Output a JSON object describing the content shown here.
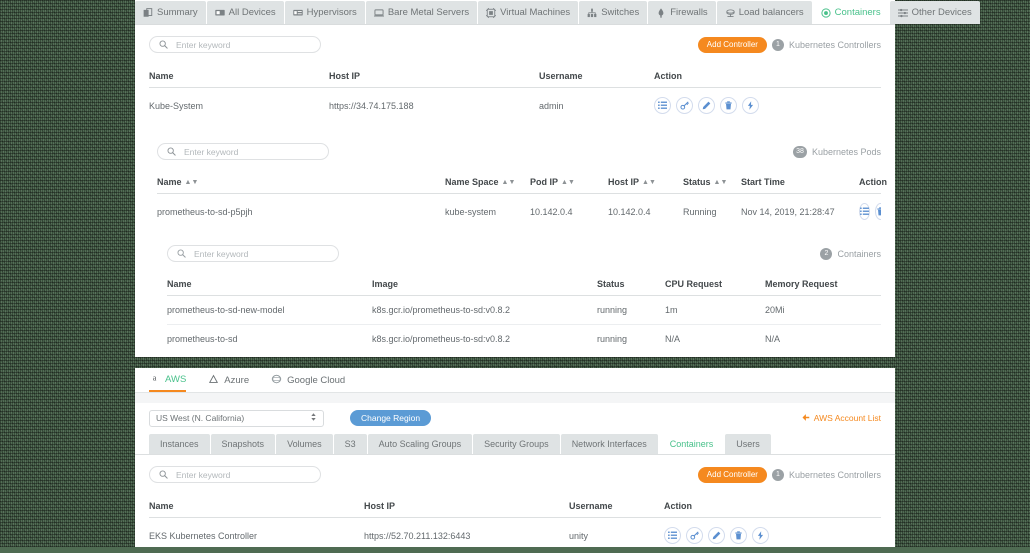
{
  "top_panel": {
    "nav_tabs": [
      {
        "label": "Summary",
        "icon": "summary-icon",
        "active": false
      },
      {
        "label": "All Devices",
        "icon": "devices-icon",
        "active": false
      },
      {
        "label": "Hypervisors",
        "icon": "hypervisor-icon",
        "active": false
      },
      {
        "label": "Bare Metal Servers",
        "icon": "server-icon",
        "active": false
      },
      {
        "label": "Virtual Machines",
        "icon": "vm-icon",
        "active": false
      },
      {
        "label": "Switches",
        "icon": "switch-icon",
        "active": false
      },
      {
        "label": "Firewalls",
        "icon": "firewall-icon",
        "active": false
      },
      {
        "label": "Load balancers",
        "icon": "loadbalancer-icon",
        "active": false
      },
      {
        "label": "Containers",
        "icon": "container-icon",
        "active": true
      },
      {
        "label": "Other Devices",
        "icon": "other-devices-icon",
        "active": false
      }
    ],
    "controllers": {
      "search_placeholder": "Enter keyword",
      "search_value": "",
      "add_button": "Add Controller",
      "count": "1",
      "count_label": "Kubernetes Controllers",
      "columns": [
        "Name",
        "Host IP",
        "Username",
        "Action"
      ],
      "rows": [
        {
          "name": "Kube-System",
          "host_ip": "https://34.74.175.188",
          "username": "admin",
          "actions": [
            "list-icon",
            "key-icon",
            "edit-icon",
            "delete-icon",
            "connect-icon"
          ]
        }
      ]
    },
    "pods": {
      "search_placeholder": "Enter keyword",
      "search_value": "",
      "count": "38",
      "count_label": "Kubernetes Pods",
      "columns": [
        "Name",
        "Name Space",
        "Pod IP",
        "Host IP",
        "Status",
        "Start Time",
        "Action"
      ],
      "sortable": [
        true,
        true,
        true,
        true,
        true,
        false,
        false
      ],
      "rows": [
        {
          "name": "prometheus-to-sd-p5pjh",
          "name_space": "kube-system",
          "pod_ip": "10.142.0.4",
          "host_ip": "10.142.0.4",
          "status": "Running",
          "start_time": "Nov 14, 2019, 21:28:47",
          "actions": [
            "list-icon",
            "delete-icon"
          ]
        }
      ]
    },
    "containers": {
      "search_placeholder": "Enter keyword",
      "search_value": "",
      "count": "2",
      "count_label": "Containers",
      "columns": [
        "Name",
        "Image",
        "Status",
        "CPU Request",
        "Memory Request"
      ],
      "rows": [
        {
          "name": "prometheus-to-sd-new-model",
          "image": "k8s.gcr.io/prometheus-to-sd:v0.8.2",
          "status": "running",
          "cpu_request": "1m",
          "memory_request": "20Mi"
        },
        {
          "name": "prometheus-to-sd",
          "image": "k8s.gcr.io/prometheus-to-sd:v0.8.2",
          "status": "running",
          "cpu_request": "N/A",
          "memory_request": "N/A"
        }
      ]
    }
  },
  "bottom_panel": {
    "cloud_tabs": [
      {
        "label": "AWS",
        "icon": "aws-icon",
        "active": true
      },
      {
        "label": "Azure",
        "icon": "azure-icon",
        "active": false
      },
      {
        "label": "Google Cloud",
        "icon": "google-cloud-icon",
        "active": false
      }
    ],
    "region": {
      "selected": "US West (N. California)",
      "change_button": "Change Region",
      "account_link": "AWS Account List"
    },
    "sub_tabs": [
      {
        "label": "Instances",
        "active": false
      },
      {
        "label": "Snapshots",
        "active": false
      },
      {
        "label": "Volumes",
        "active": false
      },
      {
        "label": "S3",
        "active": false
      },
      {
        "label": "Auto Scaling Groups",
        "active": false
      },
      {
        "label": "Security Groups",
        "active": false
      },
      {
        "label": "Network Interfaces",
        "active": false
      },
      {
        "label": "Containers",
        "active": true
      },
      {
        "label": "Users",
        "active": false
      }
    ],
    "controllers": {
      "search_placeholder": "Enter keyword",
      "search_value": "",
      "add_button": "Add Controller",
      "count": "1",
      "count_label": "Kubernetes Controllers",
      "columns": [
        "Name",
        "Host IP",
        "Username",
        "Action"
      ],
      "rows": [
        {
          "name": "EKS Kubernetes Controller",
          "host_ip": "https://52.70.211.132:6443",
          "username": "unity",
          "actions": [
            "list-icon",
            "key-icon",
            "edit-icon",
            "delete-icon",
            "connect-icon"
          ]
        }
      ]
    }
  },
  "colors": {
    "accent_orange": "#f5891f",
    "accent_green": "#49c18b",
    "accent_blue": "#5b9bd5",
    "icon_blue": "#5b8fd0",
    "backdrop": "#526e55"
  }
}
